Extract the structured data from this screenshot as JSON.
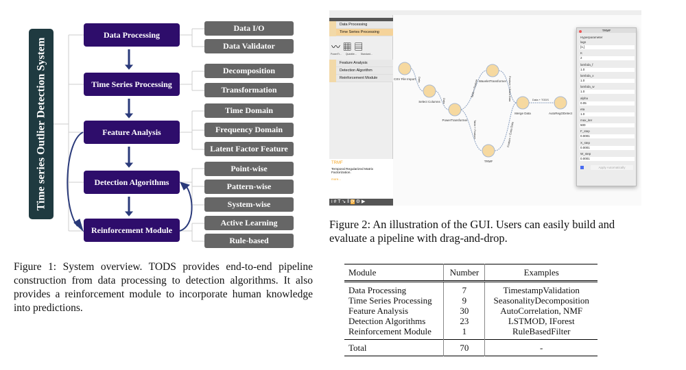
{
  "figure1": {
    "system_label": "Time series Outlier Detection System",
    "modules": [
      "Data Processing",
      "Time Series Processing",
      "Feature Analysis",
      "Detection Algorithms",
      "Reinforcement Module"
    ],
    "submodules": [
      "Data I/O",
      "Data Validator",
      "Decomposition",
      "Transformation",
      "Time Domain",
      "Frequency Domain",
      "Latent Factor Feature",
      "Point-wise",
      "Pattern-wise",
      "System-wise",
      "Active Learning",
      "Rule-based"
    ],
    "caption": "Figure 1: System overview. TODS provides end-to-end pipeline construction from data processing to detection algorithms. It also provides a reinforcement module to incorporate human knowledge into predictions.",
    "colors": {
      "module": "#2e0d6b",
      "submodule": "#666666",
      "system": "#1f3a40"
    }
  },
  "figure2": {
    "sidebar": {
      "items": [
        "Data Processing",
        "Time Series Processing",
        "Feature Analysis",
        "Detection Algorithm",
        "Reinforcement Module"
      ],
      "widgets": [
        "PowerTr...",
        "Quantile...",
        "Standard..."
      ],
      "info_title": "TRMF",
      "info_desc": "Temporal Regularized Matrix Factorization.",
      "info_more": "more..."
    },
    "nodes": [
      "CSV File Import",
      "Select Columns",
      "PowerTransformer",
      "WaveletTransformer",
      "TRMF",
      "Merge Data",
      "AutoRegODetect"
    ],
    "edges": [
      "Data",
      "Data",
      "Table + Feature",
      "Table + Feature",
      "Feature + Extra Data",
      "Feature + Extra Data",
      "Data + TODS"
    ],
    "panel": {
      "title": "TRMF",
      "section": "Hyperparameter",
      "params": [
        {
          "name": "lags",
          "value": "[1,]"
        },
        {
          "name": "K",
          "value": "2"
        },
        {
          "name": "lambda_f",
          "value": "1.0"
        },
        {
          "name": "lambda_x",
          "value": "1.0"
        },
        {
          "name": "lambda_w",
          "value": "1.0"
        },
        {
          "name": "alpha",
          "value": "0.05"
        },
        {
          "name": "eta",
          "value": "1.0"
        },
        {
          "name": "max_iter",
          "value": "500"
        },
        {
          "name": "F_step",
          "value": "0.0001"
        },
        {
          "name": "X_step",
          "value": "0.0001"
        },
        {
          "name": "W_step",
          "value": "0.0001"
        }
      ],
      "apply_label": "Apply Automatically",
      "apply_checked": true
    },
    "accent": "#f5b041",
    "caption": "Figure 2: An illustration of the GUI. Users can easily build and evaluate a pipeline with drag-and-drop."
  },
  "table": {
    "headers": [
      "Module",
      "Number",
      "Examples"
    ],
    "rows": [
      [
        "Data Processing",
        "7",
        "TimestampValidation"
      ],
      [
        "Time Series Processing",
        "9",
        "SeasonalityDecomposition"
      ],
      [
        "Feature Analysis",
        "30",
        "AutoCorrelation, NMF"
      ],
      [
        "Detection Algorithms",
        "23",
        "LSTMOD, IForest"
      ],
      [
        "Reinforcement Module",
        "1",
        "RuleBasedFilter"
      ]
    ],
    "total": [
      "Total",
      "70",
      "-"
    ]
  }
}
